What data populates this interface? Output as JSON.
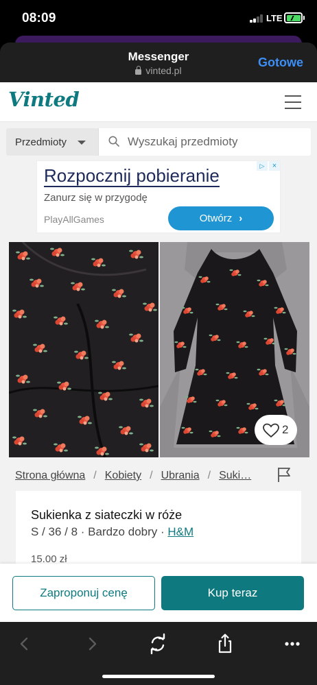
{
  "status_bar": {
    "time": "08:09",
    "network": "LTE"
  },
  "browser": {
    "title": "Messenger",
    "url": "vinted.pl",
    "done_label": "Gotowe"
  },
  "site": {
    "logo": "Vinted",
    "accent_color": "#0e7a7f"
  },
  "search": {
    "category_label": "Przedmioty",
    "placeholder": "Wyszukaj przedmioty"
  },
  "ad": {
    "title": "Rozpocznij pobieranie",
    "subtitle": "Zanurz się w przygodę",
    "brand": "PlayAllGames",
    "cta_label": "Otwórz",
    "cta_color": "#1f96d3"
  },
  "photos": {
    "favourite_count": "2"
  },
  "breadcrumb": {
    "items": [
      "Strona główna",
      "Kobiety",
      "Ubrania",
      "Suki…"
    ]
  },
  "item": {
    "title": "Sukienka z siateczki w róże",
    "meta": "S / 36 / 8 · Bardzo dobry · ",
    "brand": "H&M",
    "price": "15.00 zł"
  },
  "actions": {
    "offer_label": "Zaproponuj cenę",
    "buy_label": "Kup teraz"
  },
  "toolbar": {
    "icons": [
      "back-icon",
      "forward-icon",
      "reload-icon",
      "share-icon",
      "more-icon"
    ]
  }
}
